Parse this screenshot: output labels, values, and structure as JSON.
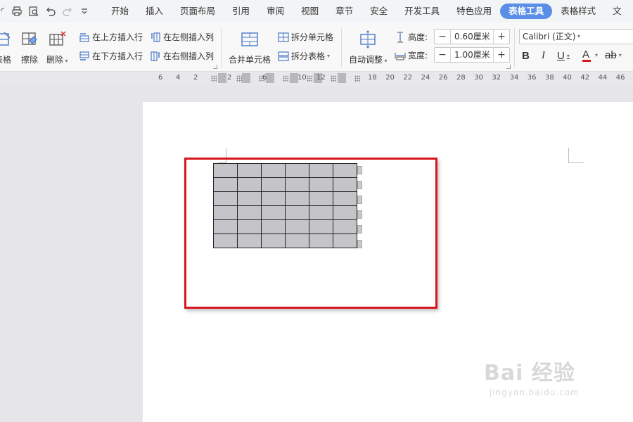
{
  "menubar": {
    "items": [
      "开始",
      "插入",
      "页面布局",
      "引用",
      "审阅",
      "视图",
      "章节",
      "安全",
      "开发工具",
      "特色应用",
      "表格工具",
      "表格样式",
      "文"
    ],
    "active_index": 10
  },
  "ribbon": {
    "draw_table": "表格",
    "erase": "擦除",
    "delete": "删除",
    "insert_above": "在上方插入行",
    "insert_below": "在下方插入行",
    "insert_left": "在左侧插入列",
    "insert_right": "在右侧插入列",
    "merge_cells": "合并单元格",
    "split_cells": "拆分单元格",
    "split_table": "拆分表格",
    "auto_fit": "自动调整",
    "height_label": "高度:",
    "height_value": "0.60厘米",
    "width_label": "宽度:",
    "width_value": "1.00厘米",
    "font_name": "Calibri (正文)",
    "bold": "B",
    "italic": "I",
    "underline": "U",
    "font_color": "A",
    "clear_format": "ab"
  },
  "ruler": {
    "left_numbers": [
      "6",
      "4",
      "2"
    ],
    "inner_numbers": [
      "2",
      "6",
      "10",
      "12"
    ],
    "right_numbers": [
      "18",
      "20",
      "22",
      "24",
      "26",
      "28",
      "30",
      "32",
      "34",
      "36",
      "38",
      "40",
      "42",
      "44",
      "46"
    ]
  },
  "table": {
    "rows": 6,
    "cols": 6
  },
  "watermark": {
    "main": "Bai 经验",
    "sub": "jingyan.baidu.com"
  },
  "colors": {
    "accent": "#5b8ee6",
    "highlight": "#d8161d",
    "cell_fill": "#c5c4c9"
  }
}
